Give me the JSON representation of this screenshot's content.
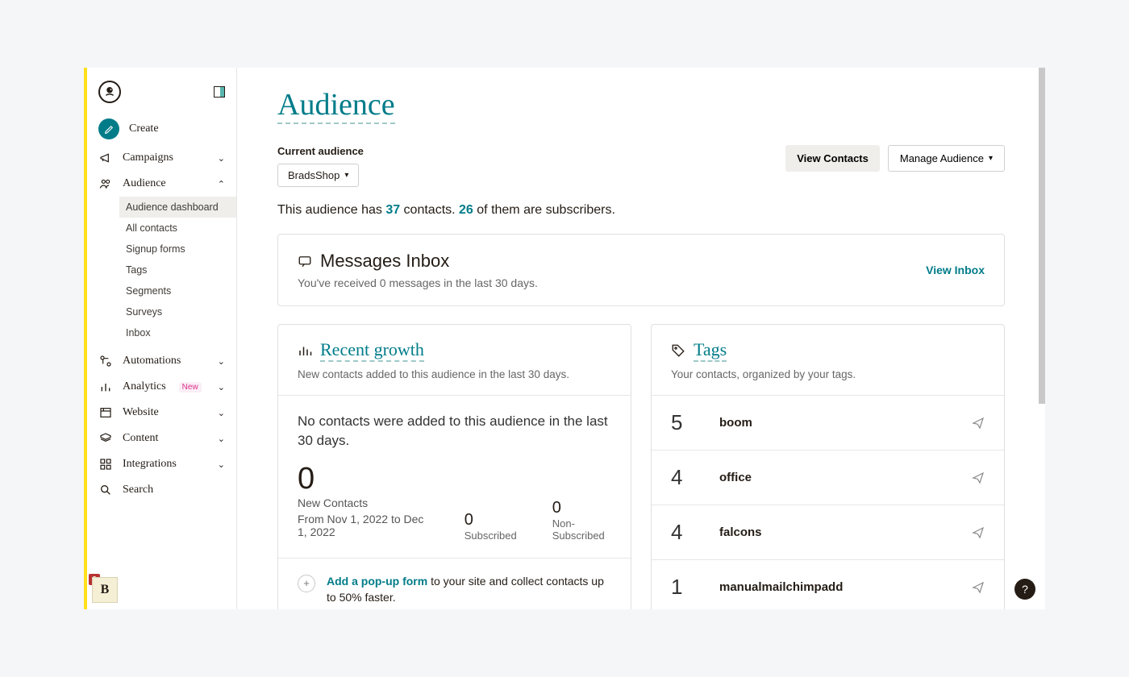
{
  "sidebar": {
    "create": "Create",
    "campaigns": "Campaigns",
    "audience": "Audience",
    "audience_sub": {
      "dashboard": "Audience dashboard",
      "all": "All contacts",
      "signup": "Signup forms",
      "tags": "Tags",
      "segments": "Segments",
      "surveys": "Surveys",
      "inbox": "Inbox"
    },
    "automations": "Automations",
    "analytics": "Analytics",
    "analytics_badge": "New",
    "website": "Website",
    "content": "Content",
    "integrations": "Integrations",
    "search": "Search",
    "account_letter": "B",
    "account_badge": "2"
  },
  "page": {
    "title": "Audience",
    "current_label": "Current audience",
    "audience_name": "BradsShop",
    "view_contacts": "View Contacts",
    "manage_audience": "Manage Audience",
    "summary_prefix": "This audience has ",
    "contacts_count": "37",
    "summary_mid": " contacts. ",
    "subscribers_count": "26",
    "summary_suffix": " of them are subscribers."
  },
  "inbox": {
    "title": "Messages Inbox",
    "subtitle": "You've received 0 messages in the last 30 days.",
    "link": "View Inbox"
  },
  "growth": {
    "title": "Recent growth",
    "subtitle": "New contacts added to this audience in the last 30 days.",
    "empty": "No contacts were added to this audience in the last 30 days.",
    "big": "0",
    "new_contacts_label": "New Contacts",
    "range": "From Nov 1, 2022 to Dec 1, 2022",
    "sub_val": "0",
    "sub_lbl": "Subscribed",
    "non_val": "0",
    "non_lbl": "Non-Subscribed",
    "popup_link": "Add a pop-up form",
    "popup_rest": " to your site and collect contacts up to 50% faster."
  },
  "tags": {
    "title": "Tags",
    "subtitle": "Your contacts, organized by your tags.",
    "items": [
      {
        "count": "5",
        "name": "boom"
      },
      {
        "count": "4",
        "name": "office"
      },
      {
        "count": "4",
        "name": "falcons"
      },
      {
        "count": "1",
        "name": "manualmailchimpadd"
      }
    ]
  },
  "help": "?"
}
